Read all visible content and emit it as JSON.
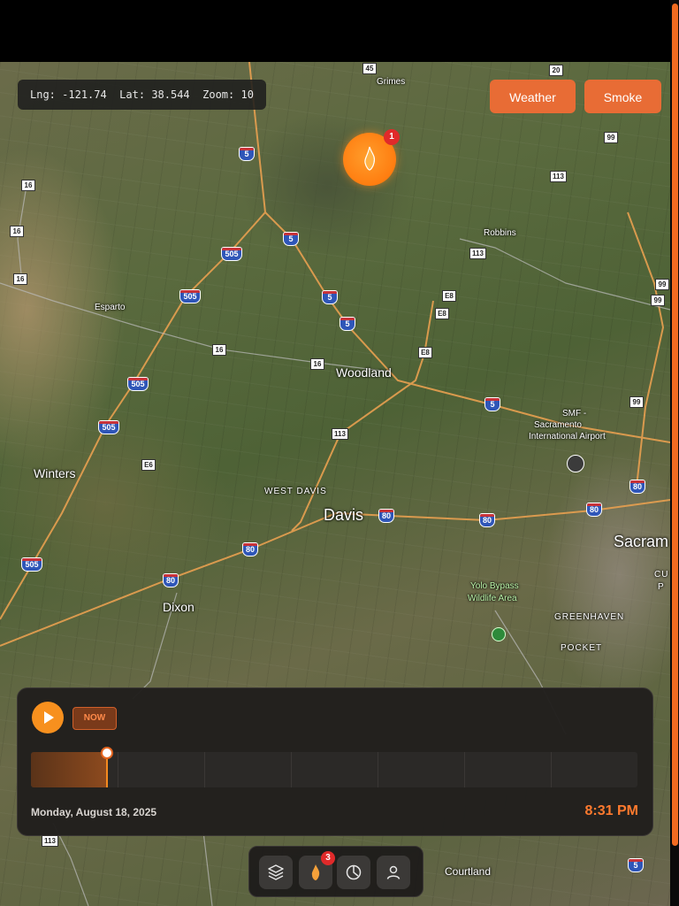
{
  "status_readout": {
    "lng_label": "Lng:",
    "lng": "-121.74",
    "lat_label": "Lat:",
    "lat": "38.544",
    "zoom_label": "Zoom:",
    "zoom": "10"
  },
  "top_buttons": {
    "weather": "Weather",
    "smoke": "Smoke"
  },
  "fire_marker": {
    "count": "1"
  },
  "places": {
    "grimes": "Grimes",
    "robbins": "Robbins",
    "esparto": "Esparto",
    "woodland": "Woodland",
    "smf_1": "SMF -",
    "smf_2": "Sacramento",
    "smf_3": "International Airport",
    "winters": "Winters",
    "west_davis": "WEST DAVIS",
    "davis": "Davis",
    "dixon": "Dixon",
    "yolo_1": "Yolo Bypass",
    "yolo_2": "Wildlife Area",
    "sacramento": "Sacram",
    "greenhaven": "GREENHAVEN",
    "pocket": "POCKET",
    "cu": "CU",
    "p": "P",
    "courtland": "Courtland"
  },
  "road_labels": {
    "i5_a": "5",
    "i5_b": "5",
    "i5_c": "5",
    "i5_d": "5",
    "i5_e": "5",
    "i5_f": "5",
    "i505_a": "505",
    "i505_b": "505",
    "i505_c": "505",
    "i505_d": "505",
    "i505_e": "505",
    "i80_a": "80",
    "i80_b": "80",
    "i80_c": "80",
    "i80_d": "80",
    "i80_e": "80",
    "i80_f": "80",
    "r45": "45",
    "r20": "20",
    "r99_a": "99",
    "r99_b": "99",
    "r99_c": "99",
    "r99_d": "99",
    "r113_a": "113",
    "r113_b": "113",
    "r113_c": "113",
    "r113_d": "113",
    "r16_a": "16",
    "r16_b": "16",
    "r16_c": "16",
    "r16_d": "16",
    "r16_e": "16",
    "e8_a": "E8",
    "e8_b": "E8",
    "e8_c": "E8",
    "e6": "E6"
  },
  "timeline": {
    "now_label": "NOW",
    "date": "Monday, August 18, 2025",
    "time": "8:31 PM",
    "progress": 0.125,
    "segments": 7
  },
  "bottom_nav": {
    "fires_badge": "3"
  },
  "colors": {
    "accent": "#e86c35",
    "timeline_orange": "#ff7a2e",
    "badge_red": "#e02a2a"
  }
}
